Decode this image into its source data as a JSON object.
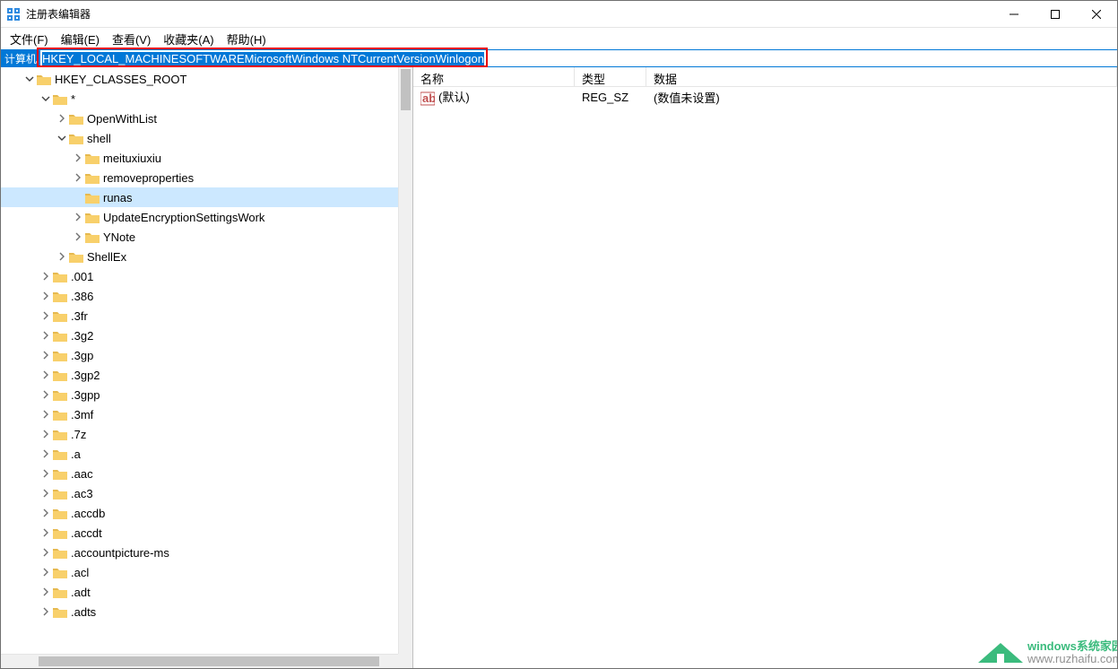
{
  "window": {
    "title": "注册表编辑器"
  },
  "menu": {
    "file": "文件(F)",
    "edit": "编辑(E)",
    "view": "查看(V)",
    "favorites": "收藏夹(A)",
    "help": "帮助(H)"
  },
  "address": {
    "label": "计算机",
    "path": "HKEY_LOCAL_MACHINESOFTWAREMicrosoftWindows NTCurrentVersionWinlogon"
  },
  "tree": [
    {
      "depth": 1,
      "expander": "open",
      "label": "HKEY_CLASSES_ROOT",
      "selected": false
    },
    {
      "depth": 2,
      "expander": "open",
      "label": "*"
    },
    {
      "depth": 3,
      "expander": "closed",
      "label": "OpenWithList"
    },
    {
      "depth": 3,
      "expander": "open",
      "label": "shell"
    },
    {
      "depth": 4,
      "expander": "closed",
      "label": "meituxiuxiu"
    },
    {
      "depth": 4,
      "expander": "closed",
      "label": "removeproperties"
    },
    {
      "depth": 4,
      "expander": "none",
      "label": "runas",
      "selected": true
    },
    {
      "depth": 4,
      "expander": "closed",
      "label": "UpdateEncryptionSettingsWork"
    },
    {
      "depth": 4,
      "expander": "closed",
      "label": "YNote"
    },
    {
      "depth": 3,
      "expander": "closed",
      "label": "ShellEx"
    },
    {
      "depth": 2,
      "expander": "closed",
      "label": ".001"
    },
    {
      "depth": 2,
      "expander": "closed",
      "label": ".386"
    },
    {
      "depth": 2,
      "expander": "closed",
      "label": ".3fr"
    },
    {
      "depth": 2,
      "expander": "closed",
      "label": ".3g2"
    },
    {
      "depth": 2,
      "expander": "closed",
      "label": ".3gp"
    },
    {
      "depth": 2,
      "expander": "closed",
      "label": ".3gp2"
    },
    {
      "depth": 2,
      "expander": "closed",
      "label": ".3gpp"
    },
    {
      "depth": 2,
      "expander": "closed",
      "label": ".3mf"
    },
    {
      "depth": 2,
      "expander": "closed",
      "label": ".7z"
    },
    {
      "depth": 2,
      "expander": "closed",
      "label": ".a"
    },
    {
      "depth": 2,
      "expander": "closed",
      "label": ".aac"
    },
    {
      "depth": 2,
      "expander": "closed",
      "label": ".ac3"
    },
    {
      "depth": 2,
      "expander": "closed",
      "label": ".accdb"
    },
    {
      "depth": 2,
      "expander": "closed",
      "label": ".accdt"
    },
    {
      "depth": 2,
      "expander": "closed",
      "label": ".accountpicture-ms"
    },
    {
      "depth": 2,
      "expander": "closed",
      "label": ".acl"
    },
    {
      "depth": 2,
      "expander": "closed",
      "label": ".adt"
    },
    {
      "depth": 2,
      "expander": "closed",
      "label": ".adts"
    }
  ],
  "list": {
    "headers": {
      "name": "名称",
      "type": "类型",
      "data": "数据"
    },
    "rows": [
      {
        "name": "(默认)",
        "type": "REG_SZ",
        "data": "(数值未设置)"
      }
    ]
  },
  "watermark": {
    "brand": "windows系统家园",
    "url": "www.ruzhaifu.com"
  }
}
